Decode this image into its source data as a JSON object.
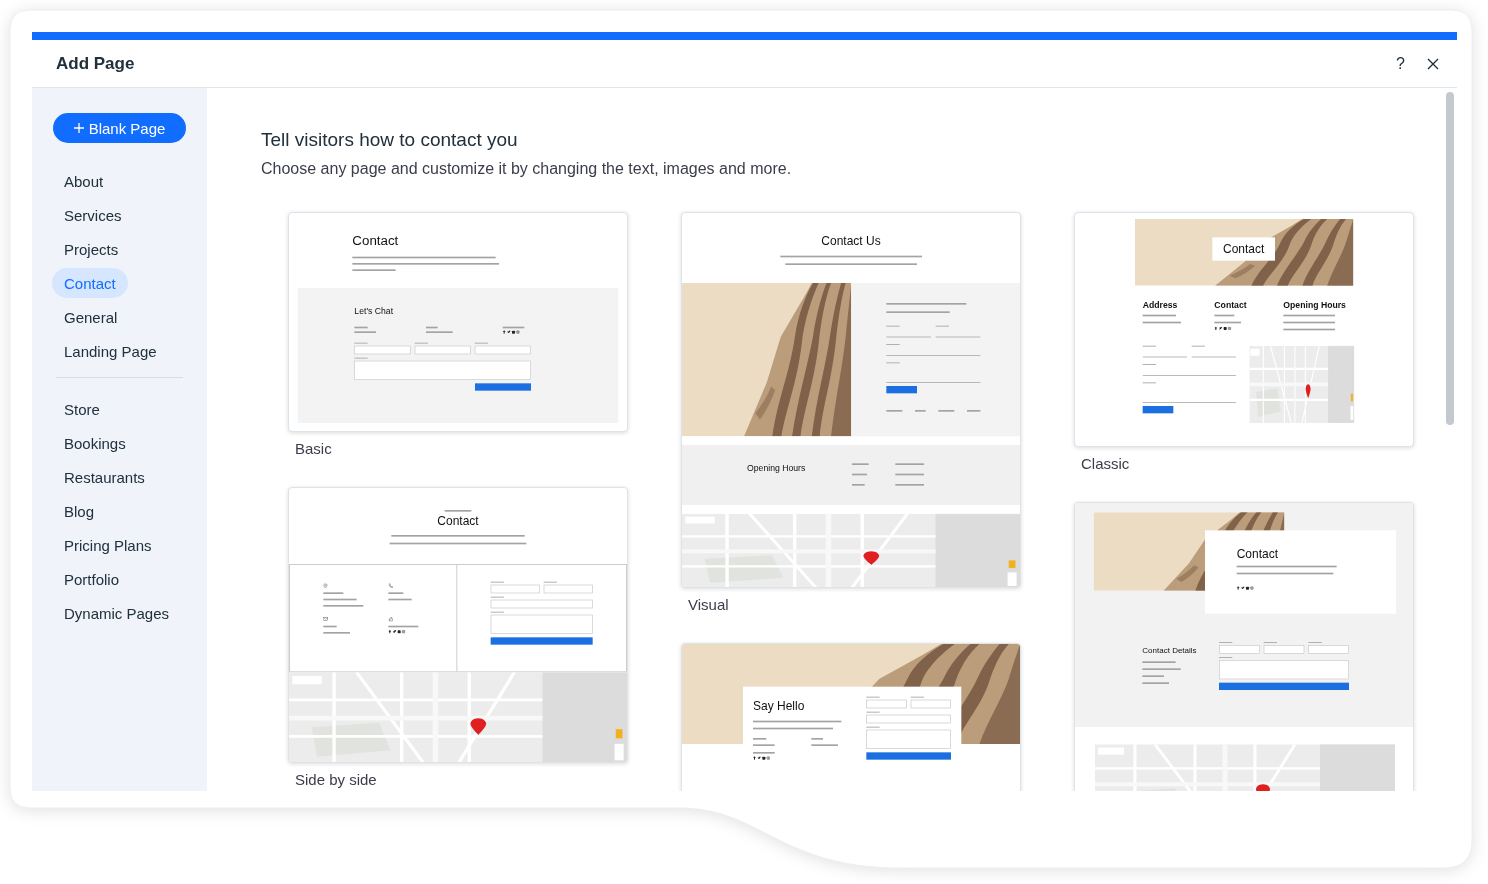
{
  "dialog": {
    "title": "Add Page",
    "help": "?"
  },
  "sidebar": {
    "blank_button": "Blank Page",
    "groups": [
      [
        {
          "label": "About",
          "selected": false
        },
        {
          "label": "Services",
          "selected": false
        },
        {
          "label": "Projects",
          "selected": false
        },
        {
          "label": "Contact",
          "selected": true
        },
        {
          "label": "General",
          "selected": false
        },
        {
          "label": "Landing Page",
          "selected": false
        }
      ],
      [
        {
          "label": "Store",
          "selected": false
        },
        {
          "label": "Bookings",
          "selected": false
        },
        {
          "label": "Restaurants",
          "selected": false
        },
        {
          "label": "Blog",
          "selected": false
        },
        {
          "label": "Pricing Plans",
          "selected": false
        },
        {
          "label": "Portfolio",
          "selected": false
        },
        {
          "label": "Dynamic Pages",
          "selected": false
        }
      ]
    ]
  },
  "main": {
    "heading": "Tell visitors how to contact you",
    "subtitle": "Choose any page and customize it by changing the text, images and more.",
    "columns": [
      [
        {
          "name": "Basic",
          "kind": "basic",
          "preview": {
            "title": "Contact",
            "section_title": "Let's Chat"
          }
        },
        {
          "name": "Side by side",
          "kind": "side_by_side",
          "preview": {
            "title": "Contact"
          }
        }
      ],
      [
        {
          "name": "Visual",
          "kind": "visual",
          "preview": {
            "title": "Contact Us",
            "hours_title": "Opening Hours"
          }
        },
        {
          "kind": "say_hello",
          "preview": {
            "title": "Say Hello"
          }
        }
      ],
      [
        {
          "name": "Classic",
          "kind": "classic",
          "preview": {
            "title": "Contact",
            "headings": [
              "Address",
              "Contact",
              "Opening Hours"
            ]
          }
        },
        {
          "kind": "overlay",
          "preview": {
            "title": "Contact",
            "details_title": "Contact Details"
          }
        }
      ]
    ]
  }
}
